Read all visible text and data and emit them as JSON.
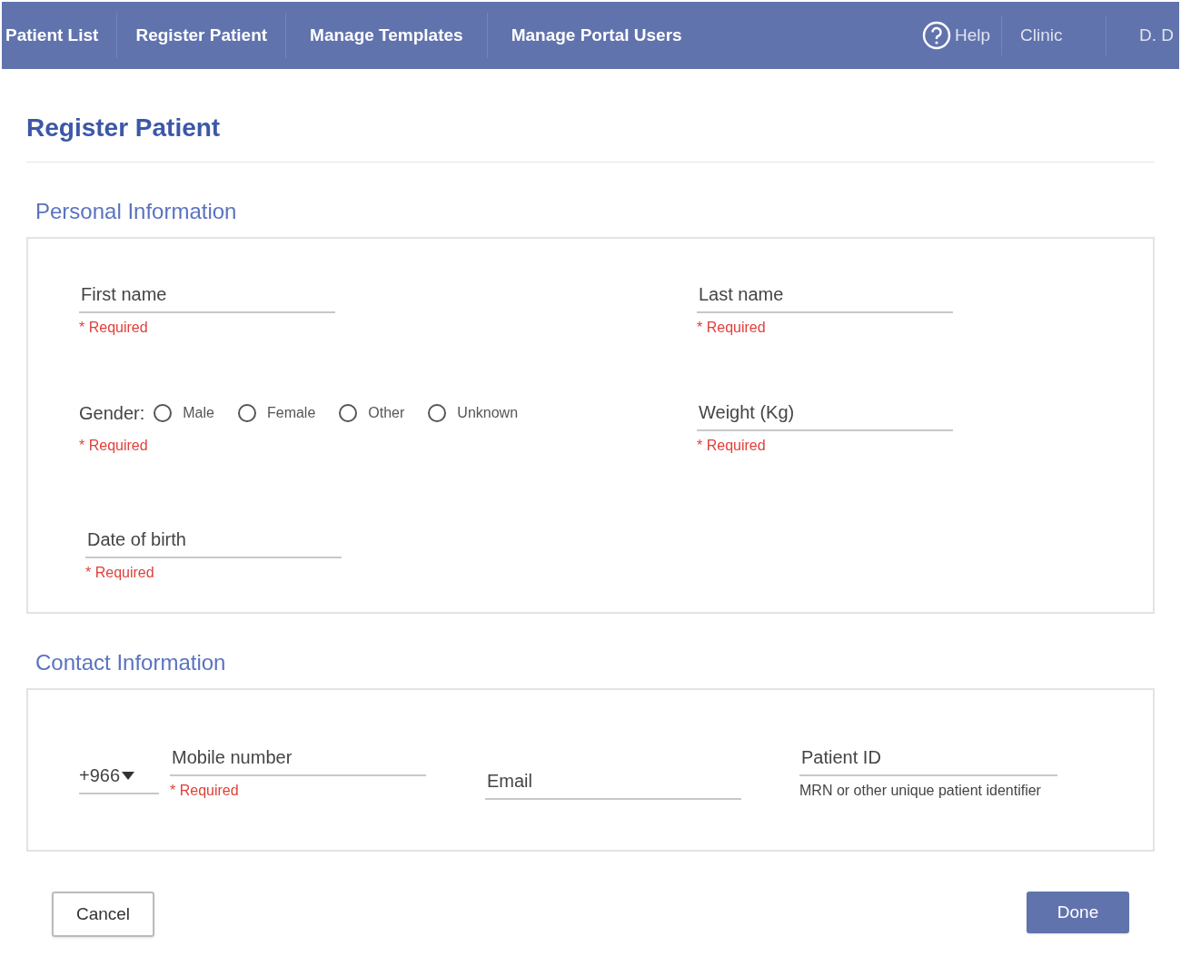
{
  "nav": {
    "items": [
      "Patient List",
      "Register Patient",
      "Manage Templates",
      "Manage Portal Users"
    ],
    "help": "Help",
    "clinic": "Clinic",
    "user": "D. D"
  },
  "page_title": "Register Patient",
  "personal": {
    "title": "Personal Information",
    "first_name": {
      "placeholder": "First name",
      "hint": "* Required"
    },
    "last_name": {
      "placeholder": "Last name",
      "hint": "* Required"
    },
    "gender": {
      "label": "Gender:",
      "options": [
        {
          "label": "Male",
          "selected": false
        },
        {
          "label": "Female",
          "selected": false
        },
        {
          "label": "Other",
          "selected": false
        },
        {
          "label": "Unknown",
          "selected": false
        }
      ],
      "hint": "* Required"
    },
    "weight": {
      "placeholder": "Weight (Kg)",
      "hint": "* Required"
    },
    "dob": {
      "placeholder": "Date of birth",
      "hint": "* Required"
    }
  },
  "contact": {
    "title": "Contact Information",
    "country_code": "+966",
    "mobile": {
      "placeholder": "Mobile number",
      "hint": "* Required"
    },
    "email": {
      "placeholder": "Email"
    },
    "patient_id": {
      "placeholder": "Patient ID",
      "hint": "MRN or other unique patient identifier"
    }
  },
  "buttons": {
    "cancel": "Cancel",
    "done": "Done"
  }
}
